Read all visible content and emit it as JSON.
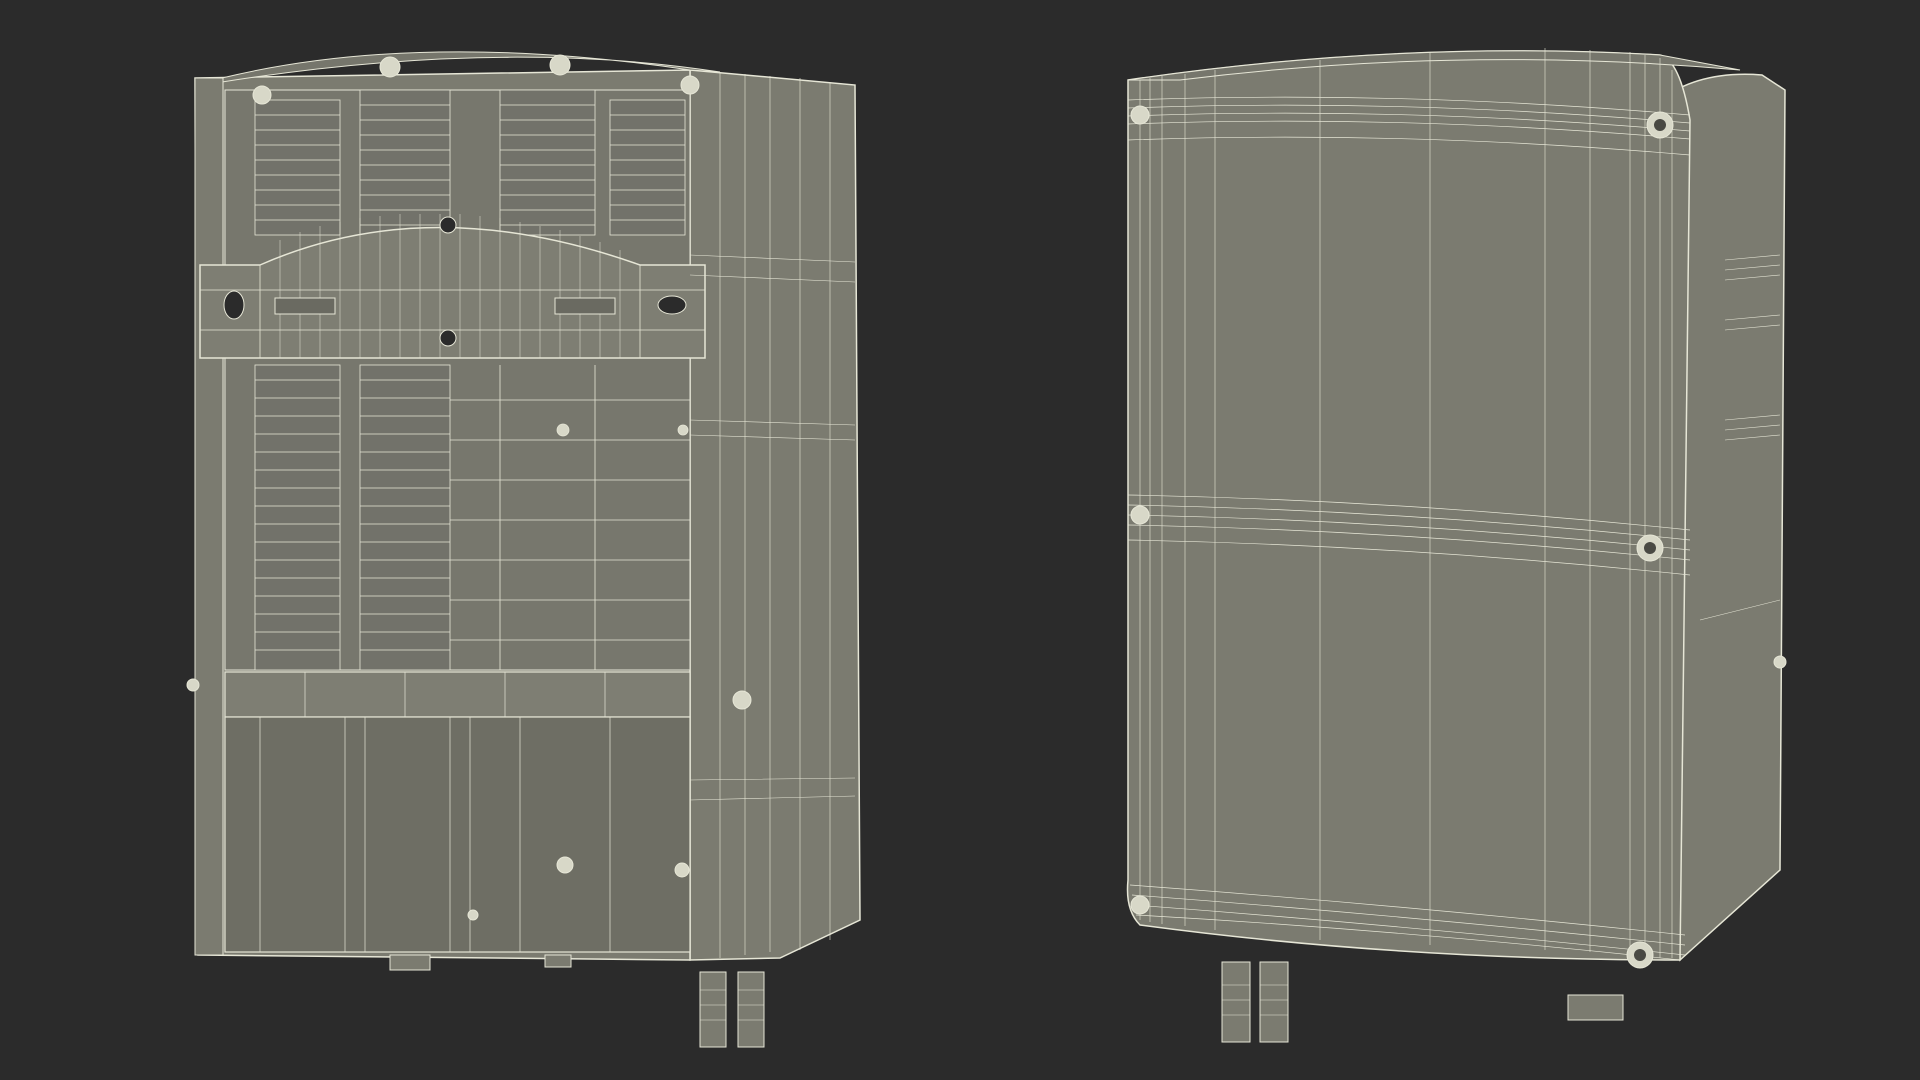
{
  "scene": {
    "description_visible_text": [],
    "background_color": "#2b2b2b",
    "model_fill_color": "#7b7b70",
    "model_fill_dark": "#6e6e64",
    "wire_color": "#e6e6d6",
    "views": [
      {
        "view": "back-open"
      },
      {
        "view": "front-closed"
      }
    ]
  }
}
